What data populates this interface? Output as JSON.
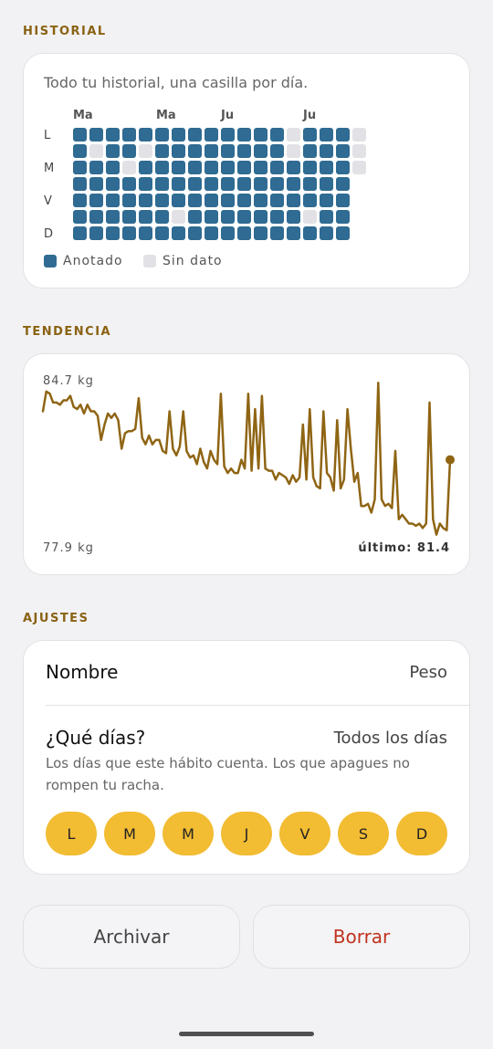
{
  "historial": {
    "section_label": "HISTORIAL",
    "caption": "Todo tu historial, una casilla por día.",
    "months": [
      "Ma",
      "Ma",
      "Ju",
      "Ju"
    ],
    "day_labels": [
      "L",
      "M",
      "V",
      "D"
    ],
    "legend": {
      "logged": "Anotado",
      "no_data": "Sin dato"
    },
    "colors": {
      "logged": "#2f6b92",
      "no_data": "#e2e2e6"
    },
    "grid_columns": [
      "1111111",
      "1011111",
      "1111111",
      "1101111",
      "1011111",
      "1111111",
      "1111101",
      "1111111",
      "1111111",
      "1111111",
      "1111111",
      "1111111",
      "1111111",
      "0011111",
      "1111101",
      "1111111",
      "1111111",
      "000"
    ]
  },
  "tendencia": {
    "section_label": "TENDENCIA",
    "max_label": "84.7 kg",
    "min_label": "77.9 kg",
    "last_label": "último: 81.4",
    "line_color": "#8f6514",
    "values": [
      83.6,
      84.5,
      84.4,
      84.0,
      84.0,
      83.9,
      84.1,
      84.1,
      84.3,
      83.8,
      83.7,
      83.9,
      83.5,
      83.9,
      83.6,
      83.6,
      83.4,
      82.3,
      83.0,
      83.5,
      83.3,
      83.5,
      83.2,
      81.9,
      82.6,
      82.7,
      82.7,
      82.8,
      84.2,
      82.4,
      82.1,
      82.5,
      82.1,
      82.3,
      82.3,
      81.8,
      81.7,
      83.6,
      81.9,
      81.6,
      82.0,
      83.6,
      81.8,
      81.5,
      81.6,
      81.2,
      81.9,
      81.3,
      81.0,
      81.8,
      81.4,
      81.2,
      84.4,
      81.1,
      80.8,
      81.0,
      80.8,
      80.8,
      81.4,
      81.0,
      84.4,
      80.9,
      83.7,
      81.0,
      84.3,
      81.0,
      80.9,
      80.9,
      80.5,
      80.8,
      80.7,
      80.6,
      80.3,
      80.7,
      80.4,
      80.6,
      83.0,
      80.5,
      83.7,
      80.6,
      80.2,
      80.1,
      83.6,
      80.8,
      80.6,
      80.0,
      83.2,
      80.1,
      80.5,
      83.7,
      81.9,
      80.4,
      80.8,
      79.3,
      79.3,
      79.4,
      79.0,
      79.6,
      84.9,
      79.6,
      79.3,
      79.4,
      79.2,
      81.8,
      78.7,
      78.9,
      78.7,
      78.5,
      78.5,
      78.4,
      78.5,
      78.3,
      78.5,
      84.0,
      78.7,
      78.0,
      78.5,
      78.3,
      78.2,
      81.4
    ],
    "ymin": 77.9,
    "ymax": 84.7
  },
  "ajustes": {
    "section_label": "AJUSTES",
    "name_label": "Nombre",
    "name_value": "Peso",
    "days_label": "¿Qué días?",
    "days_value": "Todos los días",
    "help": "Los días que este hábito cuenta. Los que apagues no rompen tu racha.",
    "weekdays": [
      "L",
      "M",
      "M",
      "J",
      "V",
      "S",
      "D"
    ],
    "weekday_color": "#f2bc33"
  },
  "actions": {
    "archive": "Archivar",
    "delete": "Borrar"
  }
}
